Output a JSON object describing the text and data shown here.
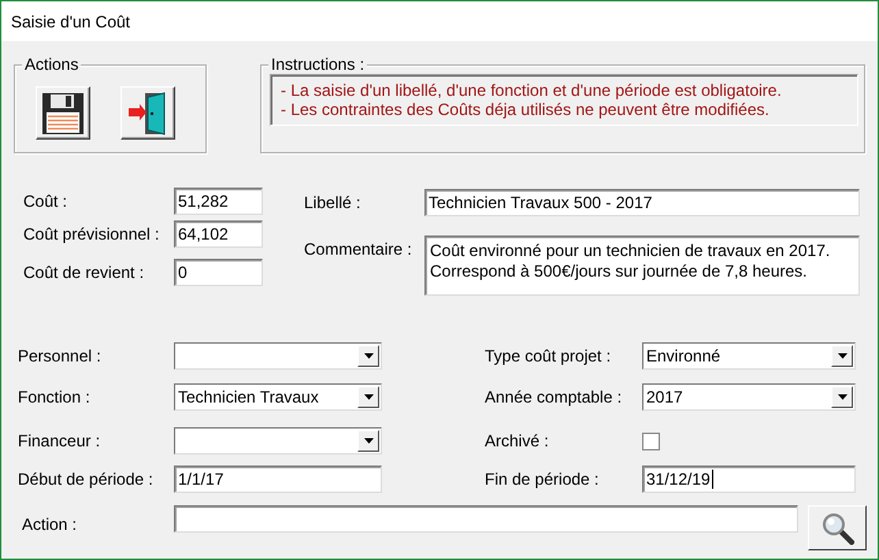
{
  "window": {
    "title": "Saisie d'un Coût"
  },
  "actions": {
    "title": "Actions",
    "buttons": [
      {
        "kind": "save"
      },
      {
        "kind": "exit"
      }
    ]
  },
  "instructions": {
    "title": "Instructions :",
    "lines": [
      "- La saisie d'un libellé, d'une fonction et d'une période est obligatoire.",
      "- Les contraintes des Coûts déja utilisés ne peuvent être modifiées."
    ]
  },
  "cost_fields": [
    {
      "label": "Coût :",
      "value": "51,282"
    },
    {
      "label": "Coût prévisionnel :",
      "value": "64,102"
    },
    {
      "label": "Coût de revient :",
      "value": "0"
    }
  ],
  "libelle": {
    "label": "Libellé :",
    "value": "Technicien Travaux 500 - 2017"
  },
  "commentaire": {
    "label": "Commentaire :",
    "lines": [
      "Coût environné pour un technicien de travaux en 2017.",
      "Correspond à 500€/jours sur journée de 7,8 heures."
    ]
  },
  "left_fields": [
    {
      "kind": "combo",
      "label": "Personnel :"
    },
    {
      "kind": "combo",
      "label": "Fonction :",
      "value": "Technicien Travaux"
    },
    {
      "kind": "combo",
      "label": "Financeur :"
    },
    {
      "kind": "text",
      "label": "Début de période :",
      "value": "1/1/17",
      "focused": false
    }
  ],
  "right_fields": [
    {
      "kind": "combo",
      "label": "Type coût projet :",
      "value": "Environné"
    },
    {
      "kind": "combo",
      "label": "Année comptable :",
      "value": "2017"
    },
    {
      "kind": "check",
      "label": "Archivé :",
      "checked": false
    },
    {
      "kind": "text",
      "label": "Fin de période :",
      "value": "31/12/19",
      "focused": true
    }
  ],
  "action": {
    "label": "Action :"
  }
}
